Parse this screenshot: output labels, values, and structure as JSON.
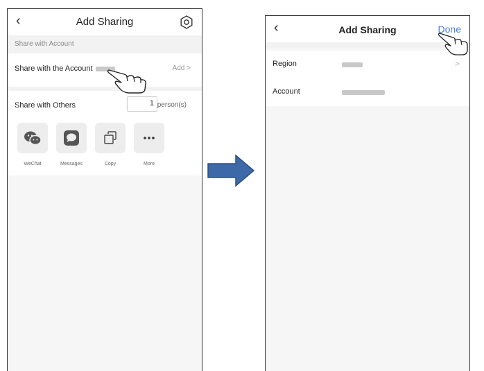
{
  "left_screen": {
    "title": "Add Sharing",
    "back_icon": "‹",
    "section_header": "Share with Account",
    "share_account_label": "Share with the Account",
    "add_label": "Add >",
    "share_others_label": "Share with Others",
    "person_count": "1",
    "person_unit": "person(s)",
    "share_options": [
      {
        "label": "WeChat",
        "icon": "wechat-icon"
      },
      {
        "label": "Messages",
        "icon": "messages-icon"
      },
      {
        "label": "Copy",
        "icon": "copy-icon"
      },
      {
        "label": "More",
        "icon": "more-icon"
      }
    ]
  },
  "right_screen": {
    "title": "Add Sharing",
    "back_icon": "‹",
    "done_label": "Done",
    "region_label": "Region",
    "region_chevron": ">",
    "account_label": "Account"
  },
  "colors": {
    "accent": "#4a7fd8",
    "arrow": "#3e69a8"
  }
}
